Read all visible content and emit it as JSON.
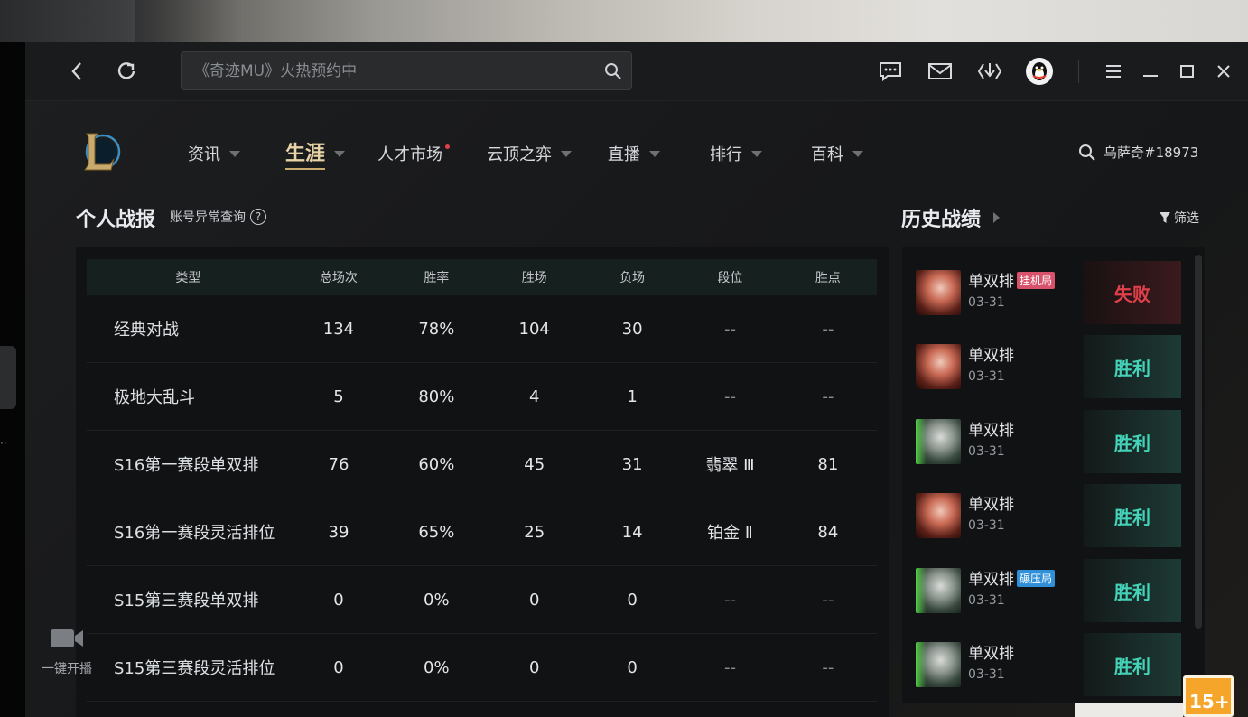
{
  "search": {
    "placeholder": "《奇迹MU》火热预约中"
  },
  "nav": {
    "items": [
      {
        "label": "资讯"
      },
      {
        "label": "生涯"
      },
      {
        "label": "人才市场"
      },
      {
        "label": "云顶之弈"
      },
      {
        "label": "直播"
      },
      {
        "label": "排行"
      },
      {
        "label": "百科"
      }
    ],
    "active": "生涯",
    "user": "乌萨奇#18973"
  },
  "stats": {
    "title": "个人战报",
    "anomaly_link": "账号异常查询",
    "headers": [
      "类型",
      "总场次",
      "胜率",
      "胜场",
      "负场",
      "段位",
      "胜点"
    ],
    "rows": [
      {
        "type": "经典对战",
        "total": "134",
        "rate": "78%",
        "wins": "104",
        "losses": "30",
        "rank": "--",
        "lp": "--"
      },
      {
        "type": "极地大乱斗",
        "total": "5",
        "rate": "80%",
        "wins": "4",
        "losses": "1",
        "rank": "--",
        "lp": "--"
      },
      {
        "type": "S16第一赛段单双排",
        "total": "76",
        "rate": "60%",
        "wins": "45",
        "losses": "31",
        "rank": "翡翠 Ⅲ",
        "lp": "81"
      },
      {
        "type": "S16第一赛段灵活排位",
        "total": "39",
        "rate": "65%",
        "wins": "25",
        "losses": "14",
        "rank": "铂金 Ⅱ",
        "lp": "84"
      },
      {
        "type": "S15第三赛段单双排",
        "total": "0",
        "rate": "0%",
        "wins": "0",
        "losses": "0",
        "rank": "--",
        "lp": "--"
      },
      {
        "type": "S15第三赛段灵活排位",
        "total": "0",
        "rate": "0%",
        "wins": "0",
        "losses": "0",
        "rank": "--",
        "lp": "--"
      }
    ]
  },
  "history": {
    "title": "历史战绩",
    "filter": "筛选",
    "matches": [
      {
        "mode": "单双排",
        "tag": "挂机局",
        "tag_color": "#d9526b",
        "date": "03-31",
        "result": "失败",
        "outcome": "lose",
        "champ": "red"
      },
      {
        "mode": "单双排",
        "tag": "",
        "date": "03-31",
        "result": "胜利",
        "outcome": "win",
        "champ": "red"
      },
      {
        "mode": "单双排",
        "tag": "",
        "date": "03-31",
        "result": "胜利",
        "outcome": "win",
        "champ": "green"
      },
      {
        "mode": "单双排",
        "tag": "",
        "date": "03-31",
        "result": "胜利",
        "outcome": "win",
        "champ": "red"
      },
      {
        "mode": "单双排",
        "tag": "碾压局",
        "tag_color": "#2f8fd8",
        "date": "03-31",
        "result": "胜利",
        "outcome": "win",
        "champ": "green"
      },
      {
        "mode": "单双排",
        "tag": "",
        "date": "03-31",
        "result": "胜利",
        "outcome": "win",
        "champ": "green"
      }
    ]
  },
  "live": {
    "label": "一键开播"
  },
  "corner_badge": {
    "text": "15+"
  },
  "colors": {
    "gold": "#c8aa6e",
    "win": "#44d3b8",
    "lose": "#e0404a"
  }
}
